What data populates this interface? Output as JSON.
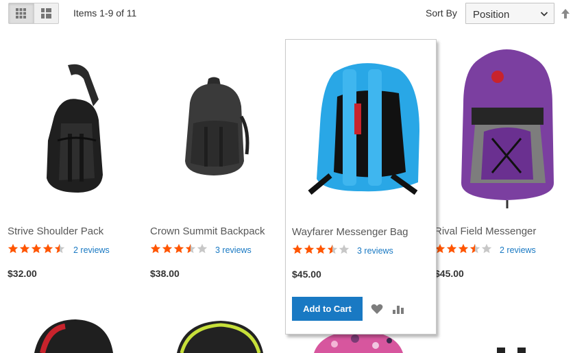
{
  "toolbar": {
    "amount": "Items 1-9 of 11",
    "sort_label": "Sort By",
    "sort_value": "Position",
    "view_modes": [
      "grid",
      "list"
    ],
    "active_view": "grid"
  },
  "products": [
    {
      "name": "Strive Shoulder Pack",
      "rating": 4.5,
      "reviews": "2 reviews",
      "price": "$32.00"
    },
    {
      "name": "Crown Summit Backpack",
      "rating": 3.5,
      "reviews": "3 reviews",
      "price": "$38.00"
    },
    {
      "name": "Wayfarer Messenger Bag",
      "rating": 3.5,
      "reviews": "3 reviews",
      "price": "$45.00",
      "add_to_cart": "Add to Cart"
    },
    {
      "name": "Rival Field Messenger",
      "rating": 3.5,
      "reviews": "2 reviews",
      "price": "$45.00"
    }
  ],
  "colors": {
    "accent": "#1979c3",
    "star": "#ff5501",
    "star_empty": "#c7c7c7"
  }
}
